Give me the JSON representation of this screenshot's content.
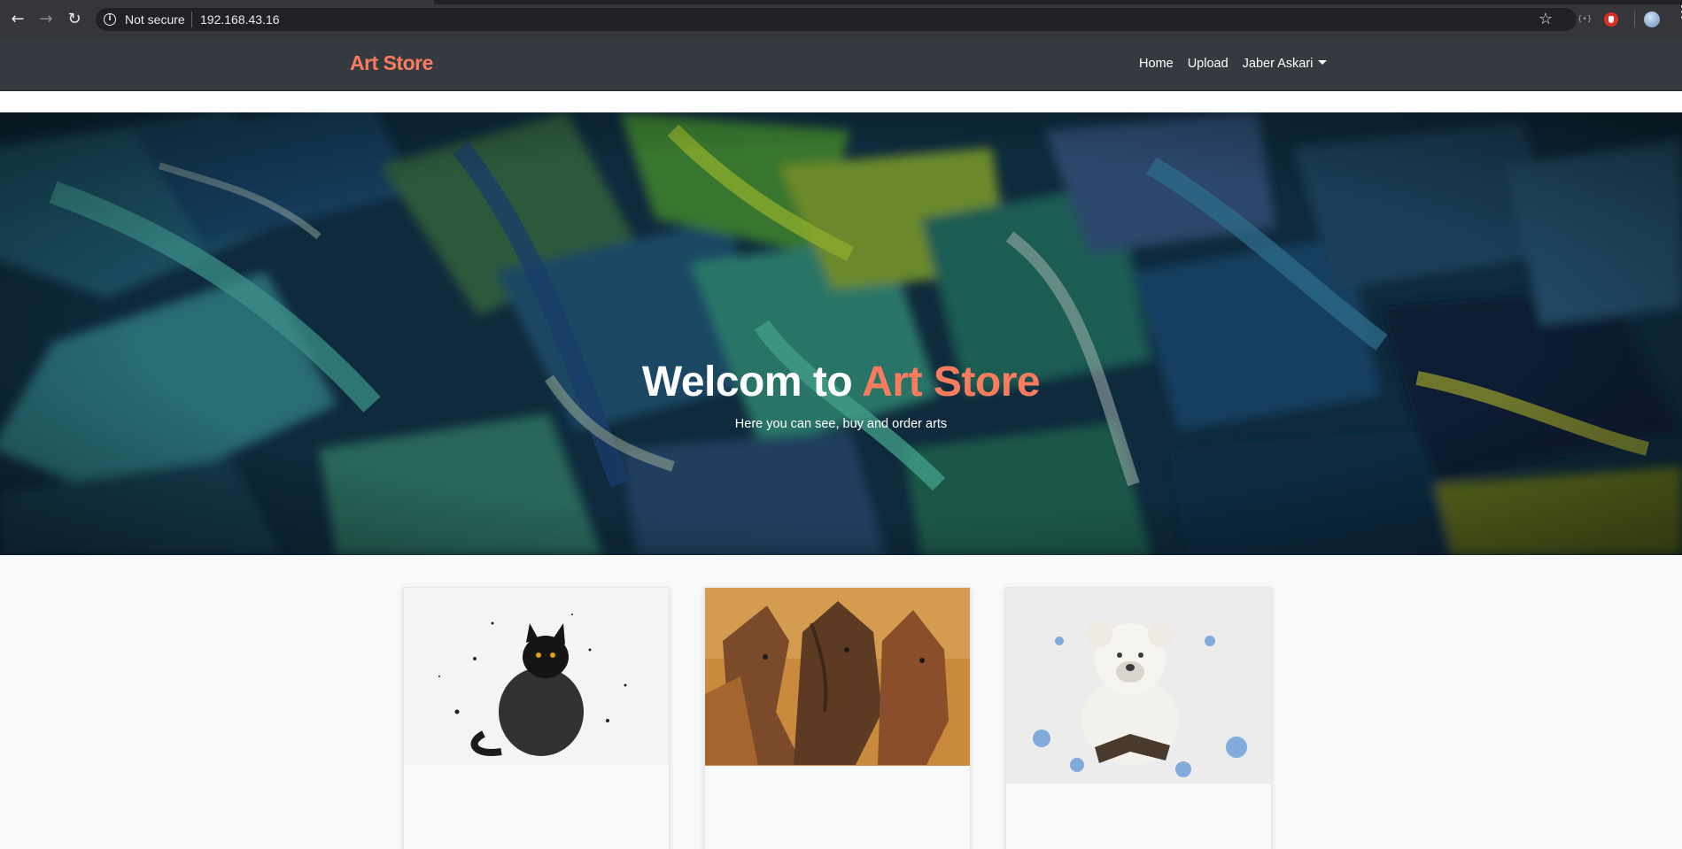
{
  "browser": {
    "back_icon": "arrow-left-icon",
    "forward_icon": "arrow-right-icon",
    "reload_icon": "reload-icon",
    "security_label": "Not secure",
    "url": "192.168.43.16",
    "bookmark_icon": "star-icon",
    "extensions": [
      "code-extension-icon",
      "stop-extension-icon"
    ],
    "profile_icon": "profile-avatar",
    "menu_icon": "more-vert-icon"
  },
  "navbar": {
    "brand": "Art Store",
    "links": [
      {
        "label": "Home"
      },
      {
        "label": "Upload"
      },
      {
        "label": "Jaber Askari"
      }
    ]
  },
  "hero": {
    "title_prefix": "Welcom to",
    "title_accent": "Art Store",
    "subtitle": "Here you can see, buy and order arts"
  },
  "colors": {
    "accent": "#fa7c5f",
    "navbar_bg": "#343a40",
    "chrome_bg": "#35363a"
  },
  "cards": [
    {
      "image": "black-cat-watercolor"
    },
    {
      "image": "horses-watercolor"
    },
    {
      "image": "teddy-bear-reading-watercolor"
    }
  ]
}
